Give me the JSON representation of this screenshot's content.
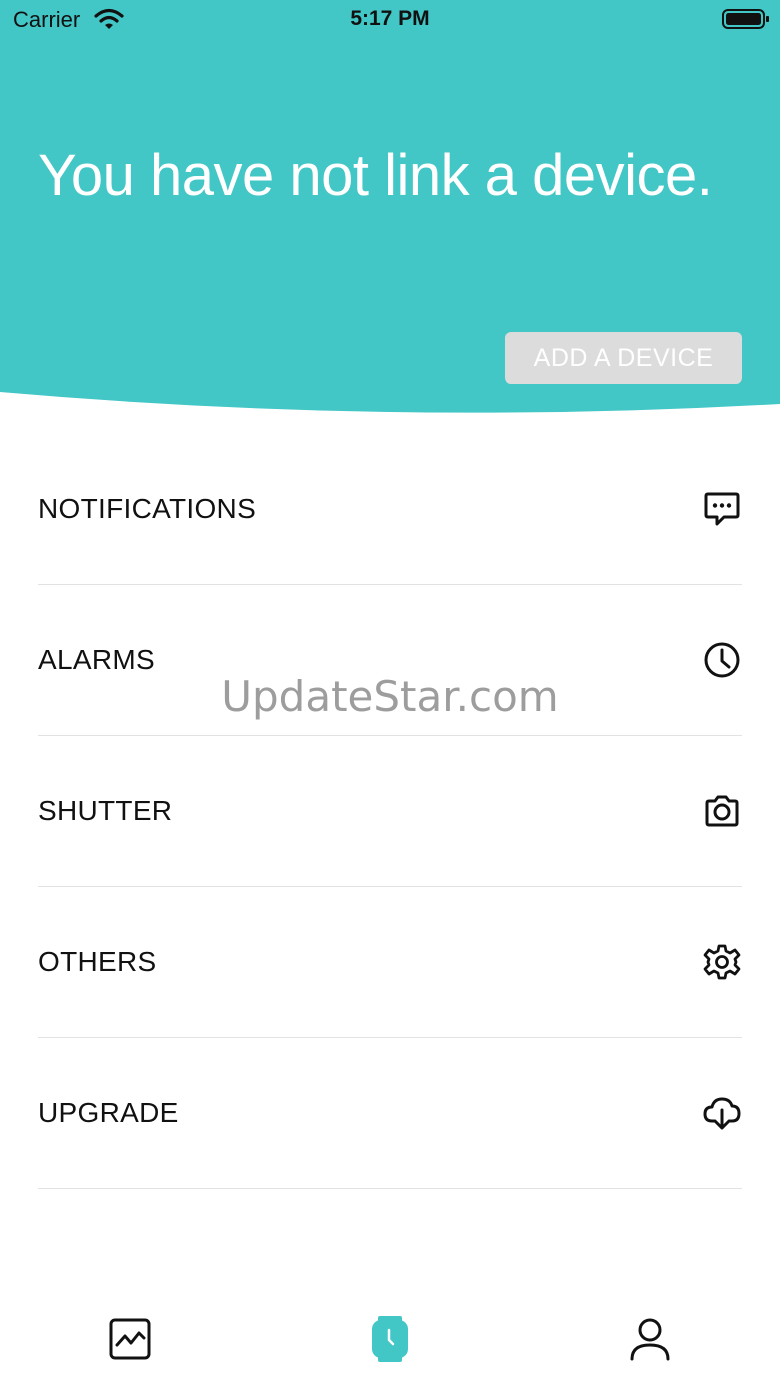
{
  "status_bar": {
    "carrier": "Carrier",
    "time": "5:17 PM"
  },
  "colors": {
    "accent": "#43c6c6",
    "button_disabled": "#dcdcdc",
    "divider": "#e2e2e2"
  },
  "hero": {
    "title": "You have not link a device.",
    "add_device_label": "ADD A DEVICE"
  },
  "menu": {
    "items": [
      {
        "label": "NOTIFICATIONS",
        "icon": "chat-bubble-icon"
      },
      {
        "label": "ALARMS",
        "icon": "clock-icon"
      },
      {
        "label": "SHUTTER",
        "icon": "camera-icon"
      },
      {
        "label": "OTHERS",
        "icon": "gear-icon"
      },
      {
        "label": "UPGRADE",
        "icon": "cloud-download-icon"
      }
    ]
  },
  "watermark": "UpdateStar.com",
  "tab_bar": {
    "tabs": [
      {
        "icon": "activity-chart-icon",
        "active": false
      },
      {
        "icon": "watch-icon",
        "active": true
      },
      {
        "icon": "person-icon",
        "active": false
      }
    ]
  }
}
